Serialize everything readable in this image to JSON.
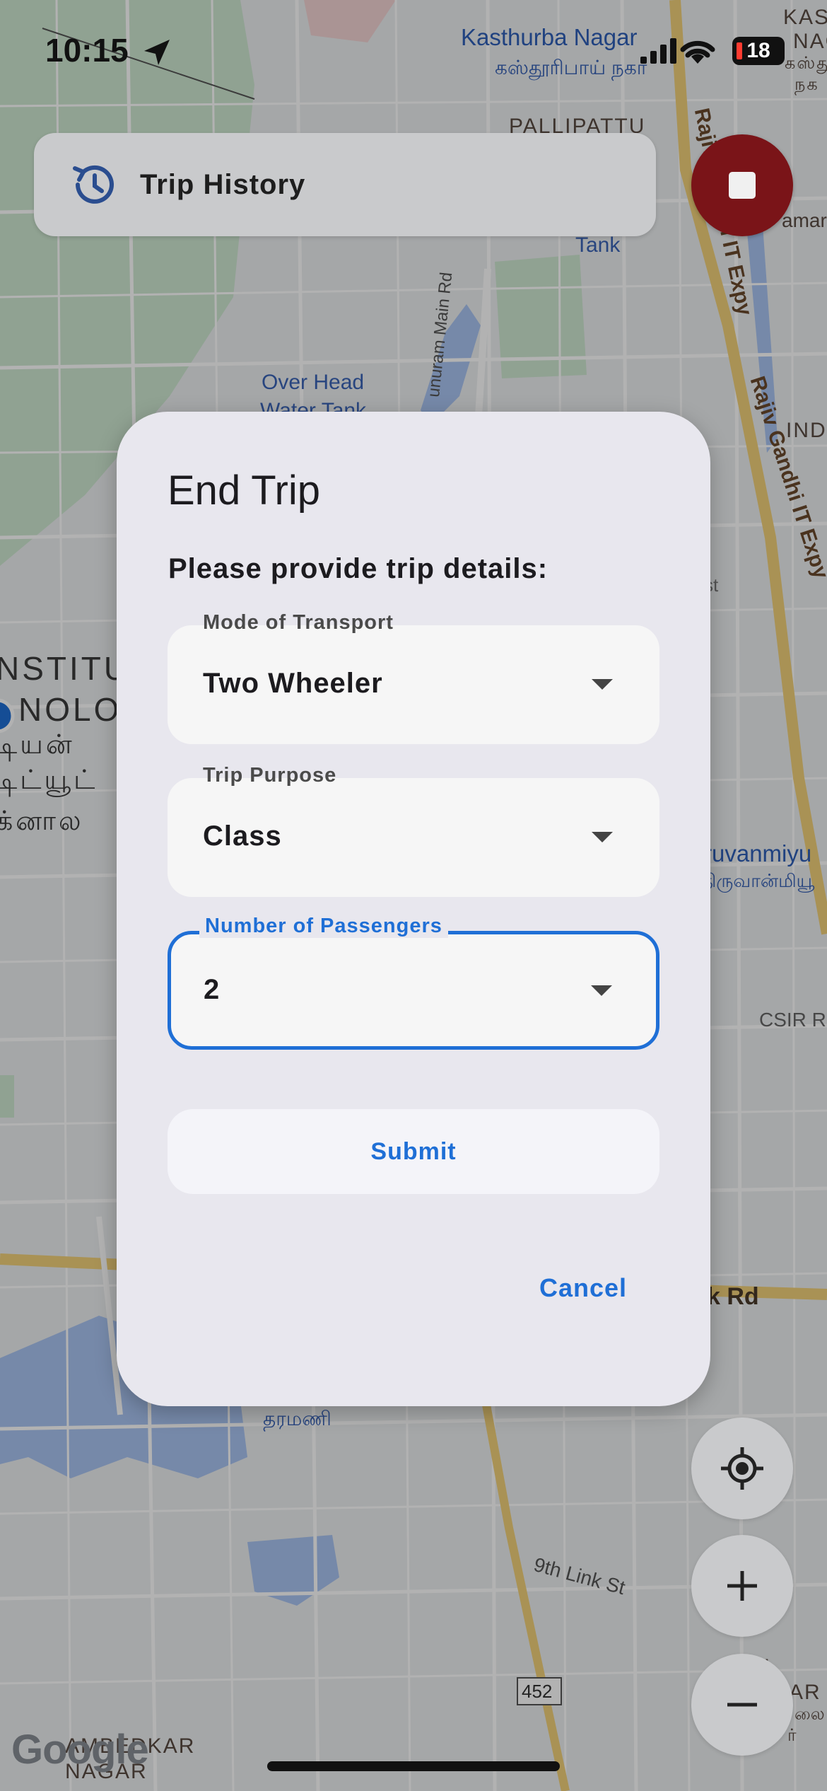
{
  "status_bar": {
    "time": "10:15",
    "battery": "18",
    "icons": [
      "location-arrow-icon",
      "cellular-signal-icon",
      "wifi-icon",
      "battery-icon"
    ]
  },
  "map": {
    "labels": {
      "kasthurba_nagar": "Kasthurba Nagar",
      "kasthurba_nagar_tamil": "கஸ்தூரிபாய் நகர்",
      "kastu": "KASTU",
      "naga": "NAGA",
      "tamil_kast": "கஸ்து",
      "tamil_naga": "நக",
      "pallipattu": "PALLIPATTU",
      "tank": "Tank",
      "amara": "amara",
      "over_head": "Over Head",
      "water_tank": "Water Tank",
      "nuram_main_rd": "unuram Main Rd",
      "rajiv_gandhi_1": "Rajiv Gandhi IT Expy",
      "rajiv_gandhi_2": "Rajiv Gandhi IT Expy",
      "ind": "IND",
      "st": "st",
      "institu": "NSTITU",
      "nolo": "NOLO",
      "tamil_inst_1": "டியன்",
      "tamil_inst_2": "டிட்யூட்",
      "tamil_inst_3": "க்னால",
      "thiruvanmiyur": "ruvanmiyu",
      "thiruvanmiyur_tamil": "திருவான்மியூ",
      "csir": "CSIR R",
      "k_rd": "k Rd",
      "taramani_tamil": "தரமணி",
      "ninth_link": "9th Link St",
      "route_452": "452",
      "ambedkar": "AMBEDKAR",
      "nagar": "NAGAR",
      "mal": "MAL",
      "ar": "AR",
      "tamil_lai": "லை",
      "tamil_r": "ர்"
    },
    "google_logo": "Google"
  },
  "top_bar": {
    "trip_history_label": "Trip History",
    "trip_history_icon": "history-icon",
    "stop_icon": "stop-icon"
  },
  "map_controls": {
    "locate_icon": "my-location-icon",
    "zoom_in_icon": "plus-icon",
    "zoom_out_icon": "minus-icon"
  },
  "dialog": {
    "title": "End Trip",
    "subtitle": "Please provide trip details:",
    "fields": [
      {
        "label": "Mode of Transport",
        "value": "Two Wheeler",
        "focused": false
      },
      {
        "label": "Trip Purpose",
        "value": "Class",
        "focused": false
      },
      {
        "label": "Number of Passengers",
        "value": "2",
        "focused": true
      }
    ],
    "submit_label": "Submit",
    "cancel_label": "Cancel"
  },
  "colors": {
    "accent": "#1f6fd6",
    "stop_button": "#7a1418",
    "dialog_bg": "#e8e7ee",
    "field_bg": "#f6f6f6"
  }
}
